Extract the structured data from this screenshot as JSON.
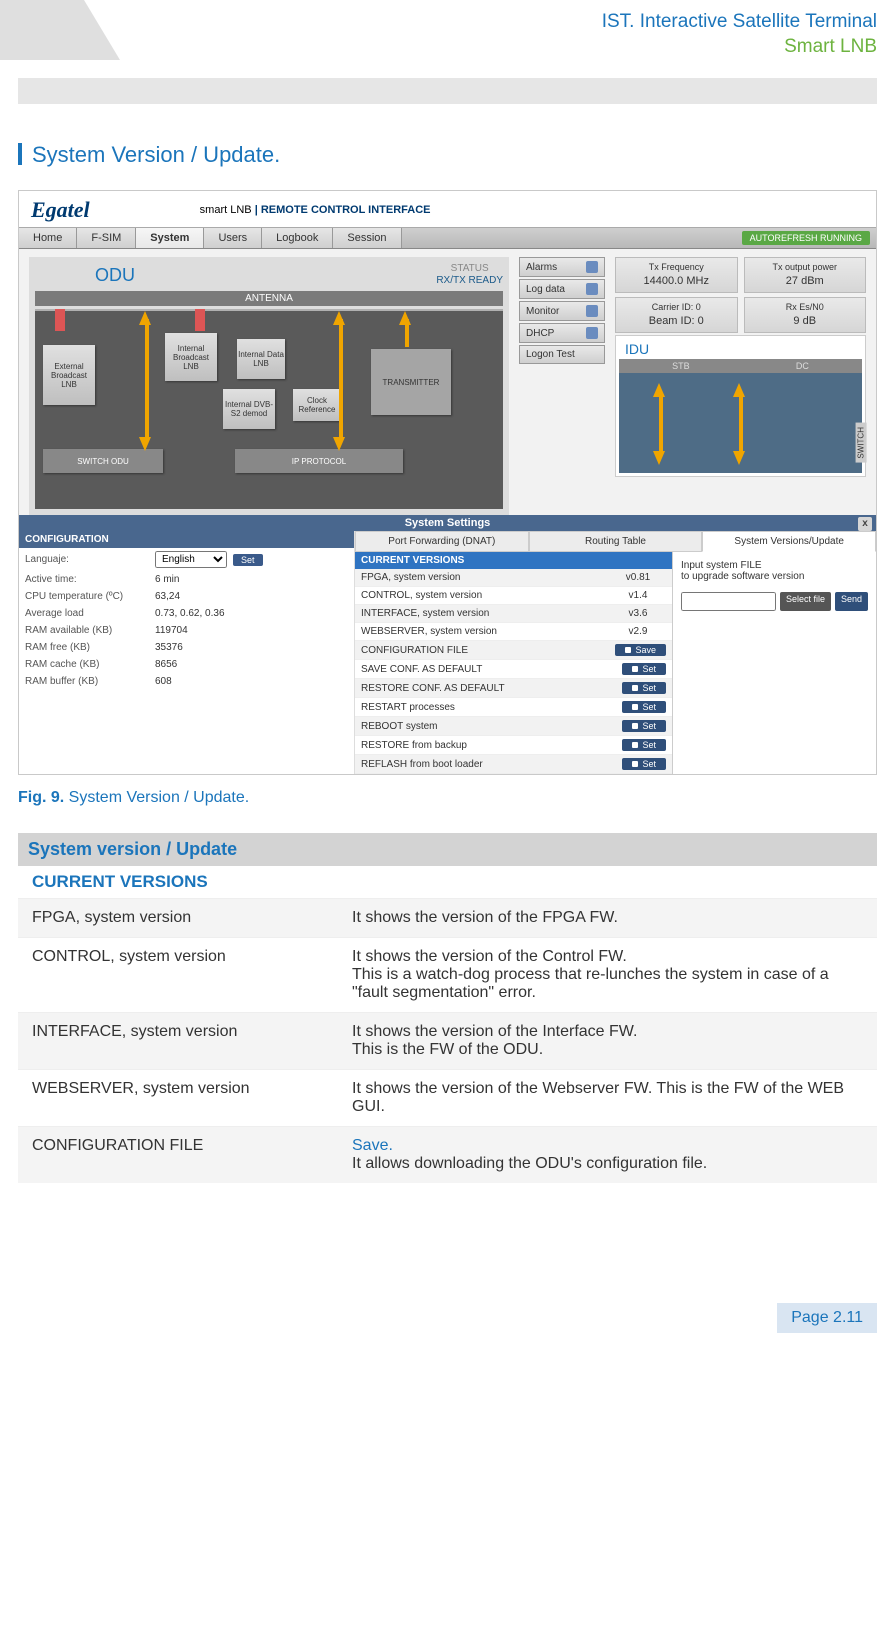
{
  "header": {
    "line1": "IST. Interactive Satellite Terminal",
    "line2": "Smart LNB"
  },
  "section_title": "System Version / Update.",
  "fig": {
    "brand": "Egatel",
    "brand_sub_a": "smart LNB",
    "brand_sub_b": " | REMOTE CONTROL INTERFACE",
    "tabs": [
      "Home",
      "F-SIM",
      "System",
      "Users",
      "Logbook",
      "Session"
    ],
    "auto": "AUTOREFRESH RUNNING",
    "odu_title": "ODU",
    "status1": "STATUS",
    "status2": "RX/TX READY",
    "antenna": "ANTENNA",
    "blocks": {
      "ext": "External\nBroadcast\nLNB",
      "ib": "Internal\nBroadcast\nLNB",
      "idata": "Internal\nData LNB",
      "idemod": "Internal\nDVB-S2\ndemod",
      "clk": "Clock\nReference",
      "tx": "TRANSMITTER",
      "sw": "SWITCH ODU",
      "ip": "IP PROTOCOL"
    },
    "side_buttons": [
      "Alarms",
      "Log data",
      "Monitor",
      "DHCP",
      "Logon Test"
    ],
    "stats": [
      {
        "k": "Tx Frequency",
        "v": "14400.0 MHz"
      },
      {
        "k": "Tx output power",
        "v": "27 dBm"
      },
      {
        "k": "Carrier ID: 0",
        "v": "Beam ID: 0"
      },
      {
        "k": "Rx Es/N0",
        "v": "9 dB"
      }
    ],
    "idu_title": "IDU",
    "idu_cols": [
      "STB",
      "DC"
    ],
    "idu_switch": "SWITCH",
    "settings_title": "System Settings",
    "settings_close": "x",
    "sub_tabs": [
      "Port Forwarding (DNAT)",
      "Routing Table",
      "System Versions/Update"
    ],
    "cfg_header": "CONFIGURATION",
    "cfg_rows": [
      {
        "k": "Languaje:",
        "type": "select",
        "v": "English",
        "btn": "Set"
      },
      {
        "k": "Active time:",
        "v": "6 min"
      },
      {
        "k": "CPU temperature (ºC)",
        "v": "63,24"
      },
      {
        "k": "Average load",
        "v": "0.73, 0.62, 0.36"
      },
      {
        "k": "RAM available (KB)",
        "v": "119704"
      },
      {
        "k": "RAM free (KB)",
        "v": "35376"
      },
      {
        "k": "RAM cache (KB)",
        "v": "8656"
      },
      {
        "k": "RAM buffer (KB)",
        "v": "608"
      }
    ],
    "cv_header": "CURRENT VERSIONS",
    "cv_rows": [
      {
        "k": "FPGA, system version",
        "v": "v0.81"
      },
      {
        "k": "CONTROL, system version",
        "v": "v1.4"
      },
      {
        "k": "INTERFACE, system version",
        "v": "v3.6"
      },
      {
        "k": "WEBSERVER, system version",
        "v": "v2.9"
      },
      {
        "k": "CONFIGURATION FILE",
        "btn": "Save"
      },
      {
        "k": "SAVE CONF. AS DEFAULT",
        "btn": "Set"
      },
      {
        "k": "RESTORE CONF. AS DEFAULT",
        "btn": "Set"
      },
      {
        "k": "RESTART processes",
        "btn": "Set"
      },
      {
        "k": "REBOOT system",
        "btn": "Set"
      },
      {
        "k": "RESTORE from backup",
        "btn": "Set"
      },
      {
        "k": "REFLASH from boot loader",
        "btn": "Set"
      }
    ],
    "upload": {
      "l1": "Input system FILE",
      "l2": "to upgrade software version",
      "select": "Select file",
      "send": "Send"
    }
  },
  "caption": {
    "fig": "Fig. 9.",
    "text": " System Version / Update."
  },
  "deftable": {
    "hdr1": "System version / Update",
    "hdr2": "CURRENT VERSIONS",
    "rows": [
      {
        "k": "FPGA, system version",
        "v": "It shows the version of the FPGA FW."
      },
      {
        "k": "CONTROL, system version",
        "v": "It shows the version of the Control FW.\nThis is a watch-dog process that re-lunches the system in case of a \"fault segmentation\" error."
      },
      {
        "k": "INTERFACE, system version",
        "v": "It shows the version of the Interface FW.\nThis is the FW of the ODU."
      },
      {
        "k": "WEBSERVER, system version",
        "v": "It shows the version of the Webserver FW. This is the FW of the WEB GUI."
      },
      {
        "k": "CONFIGURATION FILE",
        "save": "Save.",
        "v": "It allows downloading the ODU's configuration file."
      }
    ]
  },
  "page_num": "Page 2.11"
}
